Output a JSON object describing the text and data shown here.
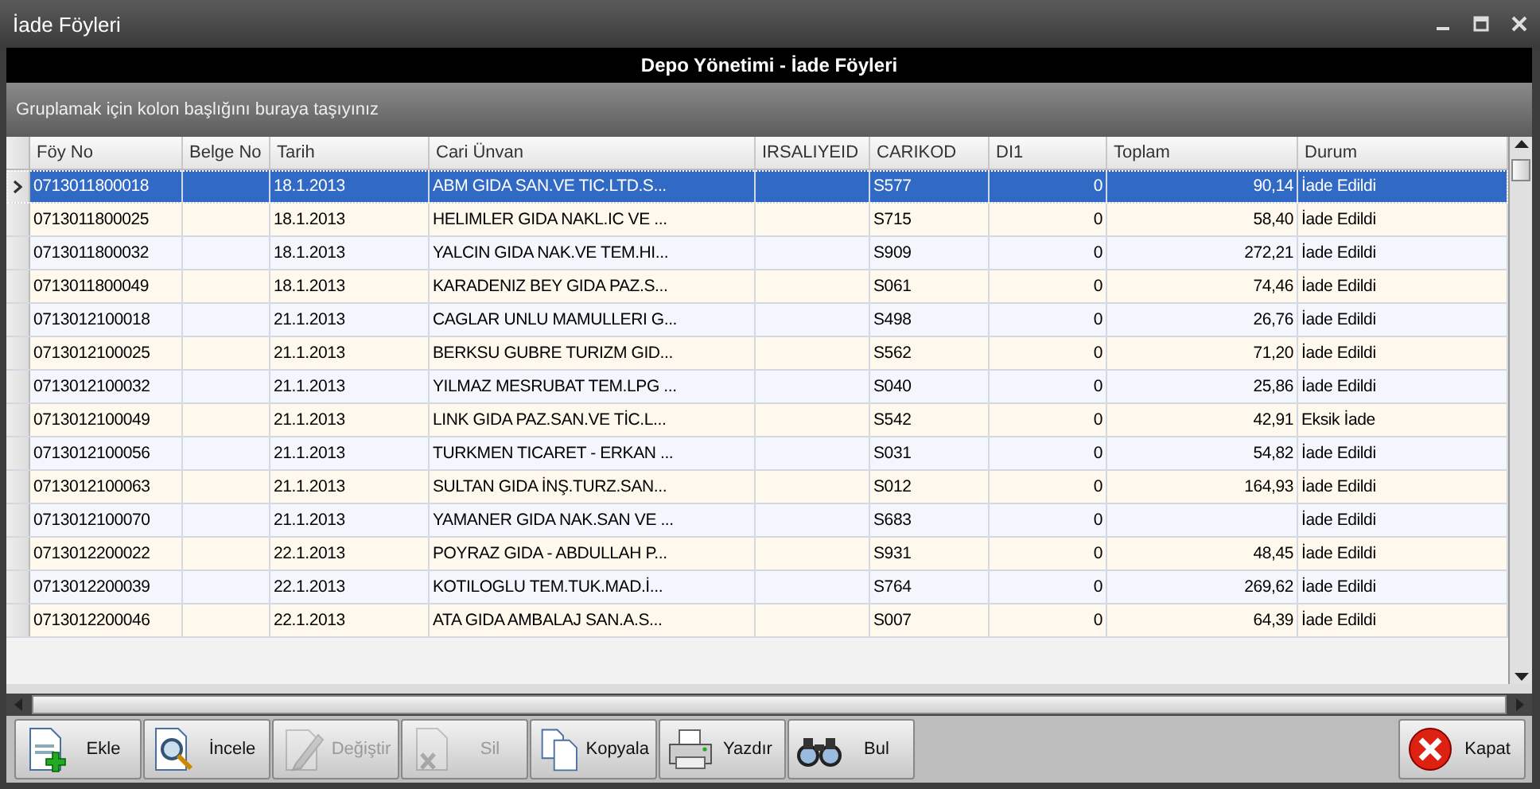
{
  "window": {
    "title": "İade Föyleri"
  },
  "header": {
    "title": "Depo Yönetimi - İade Föyleri"
  },
  "group_panel": {
    "hint": "Gruplamak için kolon başlığını buraya taşıyınız"
  },
  "table": {
    "columns": [
      "Föy No",
      "Belge No",
      "Tarih",
      "Cari Ünvan",
      "IRSALIYEID",
      "CARIKOD",
      "DI1",
      "Toplam",
      "Durum"
    ],
    "rows": [
      {
        "foy_no": "0713011800018",
        "tarih": "18.1.2013",
        "cari_unvan": "ABM GIDA SAN.VE TIC.LTD.S...",
        "carikod": "S577",
        "di1": "0",
        "toplam": "90,14",
        "durum": "İade Edildi",
        "selected": true
      },
      {
        "foy_no": "0713011800025",
        "tarih": "18.1.2013",
        "cari_unvan": "HELIMLER GIDA NAKL.IC VE ...",
        "carikod": "S715",
        "di1": "0",
        "toplam": "58,40",
        "durum": "İade Edildi",
        "selected": false
      },
      {
        "foy_no": "0713011800032",
        "tarih": "18.1.2013",
        "cari_unvan": "YALCIN GIDA NAK.VE TEM.HI...",
        "carikod": "S909",
        "di1": "0",
        "toplam": "272,21",
        "durum": "İade Edildi",
        "selected": false
      },
      {
        "foy_no": "0713011800049",
        "tarih": "18.1.2013",
        "cari_unvan": "KARADENIZ BEY GIDA PAZ.S...",
        "carikod": "S061",
        "di1": "0",
        "toplam": "74,46",
        "durum": "İade Edildi",
        "selected": false
      },
      {
        "foy_no": "0713012100018",
        "tarih": "21.1.2013",
        "cari_unvan": "CAGLAR UNLU MAMULLERI G...",
        "carikod": "S498",
        "di1": "0",
        "toplam": "26,76",
        "durum": "İade Edildi",
        "selected": false
      },
      {
        "foy_no": "0713012100025",
        "tarih": "21.1.2013",
        "cari_unvan": "BERKSU GUBRE TURIZM GID...",
        "carikod": "S562",
        "di1": "0",
        "toplam": "71,20",
        "durum": "İade Edildi",
        "selected": false
      },
      {
        "foy_no": "0713012100032",
        "tarih": "21.1.2013",
        "cari_unvan": "YILMAZ MESRUBAT TEM.LPG ...",
        "carikod": "S040",
        "di1": "0",
        "toplam": "25,86",
        "durum": "İade Edildi",
        "selected": false
      },
      {
        "foy_no": "0713012100049",
        "tarih": "21.1.2013",
        "cari_unvan": "LINK GIDA PAZ.SAN.VE TİC.L...",
        "carikod": "S542",
        "di1": "0",
        "toplam": "42,91",
        "durum": "Eksik İade",
        "selected": false
      },
      {
        "foy_no": "0713012100056",
        "tarih": "21.1.2013",
        "cari_unvan": "TURKMEN TICARET - ERKAN ...",
        "carikod": "S031",
        "di1": "0",
        "toplam": "54,82",
        "durum": "İade Edildi",
        "selected": false
      },
      {
        "foy_no": "0713012100063",
        "tarih": "21.1.2013",
        "cari_unvan": "SULTAN GIDA İNŞ.TURZ.SAN...",
        "carikod": "S012",
        "di1": "0",
        "toplam": "164,93",
        "durum": "İade Edildi",
        "selected": false
      },
      {
        "foy_no": "0713012100070",
        "tarih": "21.1.2013",
        "cari_unvan": "YAMANER GIDA NAK.SAN VE ...",
        "carikod": "S683",
        "di1": "0",
        "durum": "İade Edildi",
        "selected": false
      },
      {
        "foy_no": "0713012200022",
        "tarih": "22.1.2013",
        "cari_unvan": "POYRAZ GIDA - ABDULLAH P...",
        "carikod": "S931",
        "di1": "0",
        "toplam": "48,45",
        "durum": "İade Edildi",
        "selected": false
      },
      {
        "foy_no": "0713012200039",
        "tarih": "22.1.2013",
        "cari_unvan": "KOTILOGLU TEM.TUK.MAD.İ...",
        "carikod": "S764",
        "di1": "0",
        "toplam": "269,62",
        "durum": "İade Edildi",
        "selected": false
      },
      {
        "foy_no": "0713012200046",
        "tarih": "22.1.2013",
        "cari_unvan": "ATA GIDA AMBALAJ SAN.A.S...",
        "carikod": "S007",
        "di1": "0",
        "toplam": "64,39",
        "durum": "İade Edildi",
        "selected": false
      }
    ]
  },
  "toolbar": [
    {
      "label": "Ekle",
      "disabled": false
    },
    {
      "label": "İncele",
      "disabled": false
    },
    {
      "label": "Değiştir",
      "disabled": true
    },
    {
      "label": "Sil",
      "disabled": true
    },
    {
      "label": "Kopyala",
      "disabled": false
    },
    {
      "label": "Yazdır",
      "disabled": false
    },
    {
      "label": "Bul",
      "disabled": false
    }
  ],
  "close_button": {
    "label": "Kapat"
  }
}
